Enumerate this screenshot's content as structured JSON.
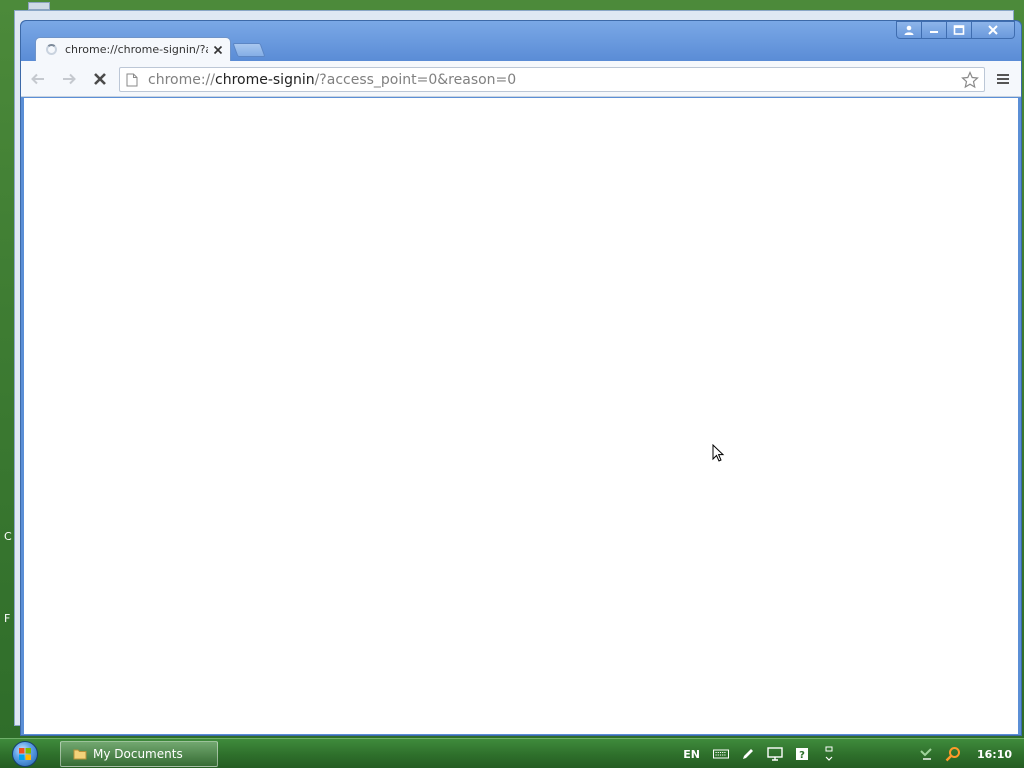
{
  "desktop": {
    "edge_letters": [
      "C",
      "F"
    ]
  },
  "browser": {
    "tab": {
      "title": "chrome://chrome-signin/?access_point=0&reason=0",
      "loading": true
    },
    "toolbar": {
      "url_scheme": "chrome://",
      "url_host": "chrome-signin",
      "url_rest": "/?access_point=0&reason=0",
      "back_icon": "back-arrow-icon",
      "forward_icon": "forward-arrow-icon",
      "stop_icon": "stop-x-icon",
      "bookmark_icon": "star-icon",
      "menu_icon": "hamburger-menu-icon"
    },
    "caption_buttons": [
      "user-icon",
      "minimize-icon",
      "maximize-icon",
      "close-icon"
    ]
  },
  "taskbar": {
    "start_icon": "windows-orb-icon",
    "items": [
      {
        "label": "My Documents",
        "icon": "folder-icon"
      }
    ],
    "tray": {
      "language": "EN",
      "clock": "16:10",
      "icons": [
        "keyboard-icon",
        "pen-icon",
        "display-icon",
        "help-icon",
        "arrows-icon",
        "network-icon",
        "search-icon"
      ]
    }
  },
  "colors": {
    "window_frame": "#5b8fd6",
    "taskbar": "#2e6f2b",
    "desktop": "#3f7d33"
  }
}
